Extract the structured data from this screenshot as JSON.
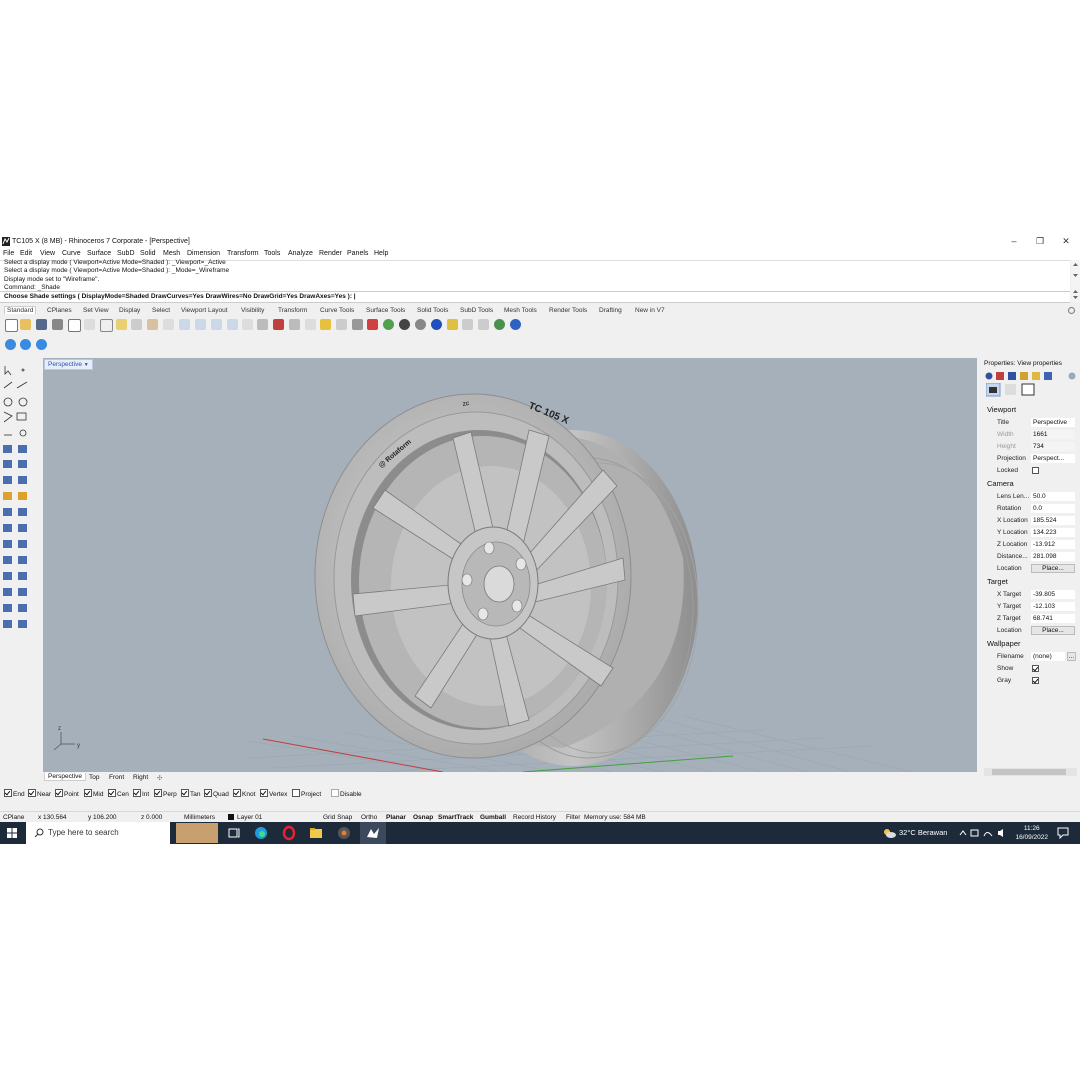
{
  "window": {
    "title": "TC105 X (8 MB) - Rhinoceros 7 Corporate - [Perspective]",
    "minimize": "–",
    "restore": "❐",
    "close": "✕"
  },
  "menu": [
    "File",
    "Edit",
    "View",
    "Curve",
    "Surface",
    "SubD",
    "Solid",
    "Mesh",
    "Dimension",
    "Transform",
    "Tools",
    "Analyze",
    "Render",
    "Panels",
    "Help"
  ],
  "command_history": [
    "Select a display mode ( Viewport=Active  Mode=Shaded ): _Viewport=_Active",
    "Select a display mode ( Viewport=Active  Mode=Shaded ): _Mode=_Wireframe",
    "Display mode set to \"Wireframe\".",
    "Command: _Shade"
  ],
  "command_prompt": "Choose Shade settings ( DisplayMode=Shaded  DrawCurves=Yes  DrawWires=No  DrawGrid=Yes  DrawAxes=Yes ): |",
  "toolbar_tabs": [
    "Standard",
    "CPlanes",
    "Set View",
    "Display",
    "Select",
    "Viewport Layout",
    "Visibility",
    "Transform",
    "Curve Tools",
    "Surface Tools",
    "Solid Tools",
    "SubD Tools",
    "Mesh Tools",
    "Render Tools",
    "Drafting",
    "New in V7"
  ],
  "viewport": {
    "name": "Perspective",
    "dropdown": "▼",
    "axis_z": "z",
    "axis_y": "y",
    "wheel_text_rim": "TC 105 X",
    "wheel_text_brand": "@ Rotaform",
    "wheel_text_small": "ZC"
  },
  "view_tabs": [
    "Perspective",
    "Top",
    "Front",
    "Right"
  ],
  "view_tab_add": "✣",
  "osnaps": [
    {
      "label": "End",
      "checked": true
    },
    {
      "label": "Near",
      "checked": true
    },
    {
      "label": "Point",
      "checked": true
    },
    {
      "label": "Mid",
      "checked": true
    },
    {
      "label": "Cen",
      "checked": true
    },
    {
      "label": "Int",
      "checked": true
    },
    {
      "label": "Perp",
      "checked": true
    },
    {
      "label": "Tan",
      "checked": true
    },
    {
      "label": "Quad",
      "checked": true
    },
    {
      "label": "Knot",
      "checked": true
    },
    {
      "label": "Vertex",
      "checked": true
    },
    {
      "label": "Project",
      "checked": false
    },
    {
      "label": "Disable",
      "checked": false
    }
  ],
  "status": {
    "cplane": "CPlane",
    "x": "x 130.564",
    "y": "y 106.200",
    "z": "z 0.000",
    "units": "Millimeters",
    "layer": "Layer 01",
    "grid_snap": "Grid Snap",
    "ortho": "Ortho",
    "planar": "Planar",
    "osnap": "Osnap",
    "smarttrack": "SmartTrack",
    "gumball": "Gumball",
    "record_history": "Record History",
    "filter": "Filter",
    "memory": "Memory use: 584 MB"
  },
  "taskbar": {
    "search_placeholder": "Type here to search",
    "weather": "32°C  Berawan",
    "time": "11:26",
    "date": "16/09/2022"
  },
  "properties": {
    "title": "Properties: View properties",
    "viewport_section": "Viewport",
    "title_label": "Title",
    "title_value": "Perspective",
    "width_label": "Width",
    "width_value": "1661",
    "height_label": "Height",
    "height_value": "734",
    "projection_label": "Projection",
    "projection_value": "Perspect...",
    "locked_label": "Locked",
    "camera_section": "Camera",
    "lens_label": "Lens Len...",
    "lens_value": "50.0",
    "rotation_label": "Rotation",
    "rotation_value": "0.0",
    "xloc_label": "X Location",
    "xloc_value": "185.524",
    "yloc_label": "Y Location",
    "yloc_value": "134.223",
    "zloc_label": "Z Location",
    "zloc_value": "-13.912",
    "distance_label": "Distance...",
    "distance_value": "281.098",
    "location_label": "Location",
    "place_button": "Place...",
    "target_section": "Target",
    "xtarget_label": "X Target",
    "xtarget_value": "-39.805",
    "ytarget_label": "Y Target",
    "ytarget_value": "-12.103",
    "ztarget_label": "Z Target",
    "ztarget_value": "68.741",
    "tlocation_label": "Location",
    "tplace_button": "Place...",
    "wallpaper_section": "Wallpaper",
    "filename_label": "Filename",
    "filename_value": "(none)",
    "browse_button": "...",
    "show_label": "Show",
    "gray_label": "Gray"
  },
  "colors": {
    "viewport_bg": "#a6b0bb",
    "taskbar": "#1c2a3a",
    "accent_blue": "#2b4fb0"
  }
}
